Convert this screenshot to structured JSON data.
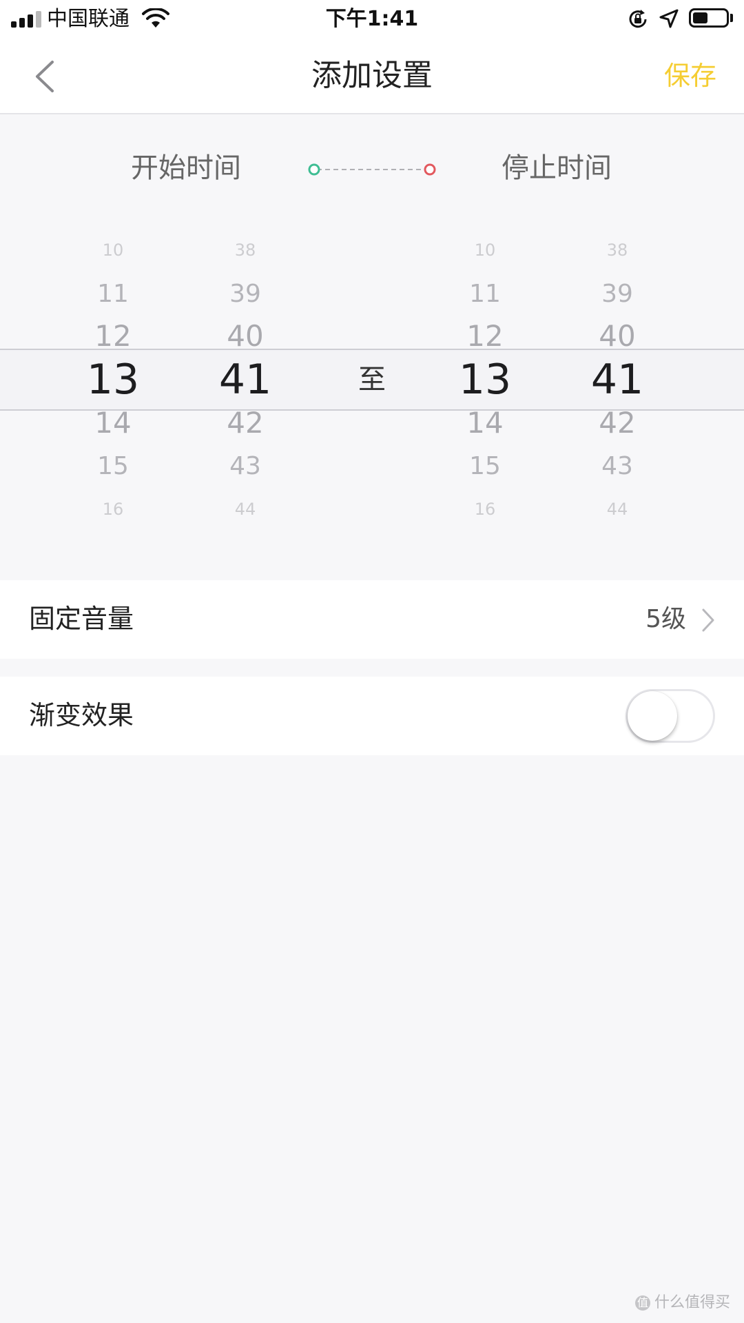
{
  "status_bar": {
    "carrier": "中国联通",
    "time": "下午1:41",
    "battery_level": 0.45,
    "icons": [
      "signal-icon",
      "wifi-icon",
      "orientation-lock-icon",
      "location-icon",
      "battery-icon"
    ]
  },
  "nav": {
    "back_icon": "chevron-left-icon",
    "title": "添加设置",
    "save_label": "保存",
    "accent_color": "#f5cd32"
  },
  "time_range": {
    "start_label": "开始时间",
    "stop_label": "停止时间",
    "start_dot_color": "#3ebd93",
    "stop_dot_color": "#e2585e",
    "separator": "至"
  },
  "picker": {
    "start_hour": {
      "items": [
        "10",
        "11",
        "12",
        "13",
        "14",
        "15",
        "16"
      ],
      "selected": "13"
    },
    "start_minute": {
      "items": [
        "38",
        "39",
        "40",
        "41",
        "42",
        "43",
        "44"
      ],
      "selected": "41"
    },
    "stop_hour": {
      "items": [
        "10",
        "11",
        "12",
        "13",
        "14",
        "15",
        "16"
      ],
      "selected": "13"
    },
    "stop_minute": {
      "items": [
        "38",
        "39",
        "40",
        "41",
        "42",
        "43",
        "44"
      ],
      "selected": "41"
    }
  },
  "settings": {
    "volume": {
      "label": "固定音量",
      "value": "5级",
      "icon": "chevron-right-icon"
    },
    "fade": {
      "label": "渐变效果",
      "enabled": false
    }
  },
  "watermark": {
    "text": "什么值得买",
    "icon_glyph": "值"
  }
}
